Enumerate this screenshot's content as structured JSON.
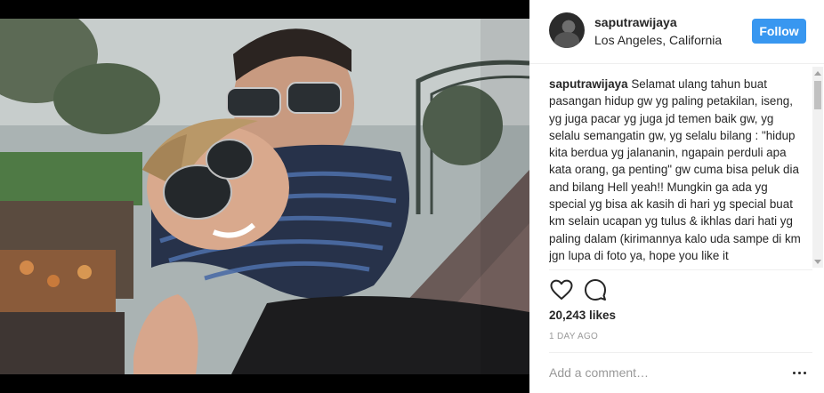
{
  "post": {
    "username": "saputrawijaya",
    "location": "Los Angeles, California",
    "follow_label": "Follow",
    "caption_username": "saputrawijaya",
    "caption_text": "Selamat ulang tahun buat pasangan hidup gw yg paling petakilan, iseng, yg juga pacar yg juga jd temen baik gw, yg selalu semangatin gw, yg selalu bilang : \"hidup kita berdua yg jalananin, ngapain perduli apa kata orang, ga penting\" gw cuma bisa peluk dia and bilang Hell yeah!! Mungkin ga ada yg special yg bisa ak kasih di hari yg special buat km selain ucapan yg tulus & ikhlas dari hati yg paling dalam (kirimannya kalo uda sampe di km jgn lupa di foto ya, hope you like it",
    "likes": "20,243 likes",
    "time": "1 DAY AGO",
    "comment_placeholder": "Add a comment…"
  },
  "icons": {
    "like": "heart-icon",
    "comment": "comment-icon",
    "more": "more-options-icon"
  },
  "colors": {
    "follow_button": "#3897f0",
    "text": "#262626",
    "muted": "#999999"
  }
}
